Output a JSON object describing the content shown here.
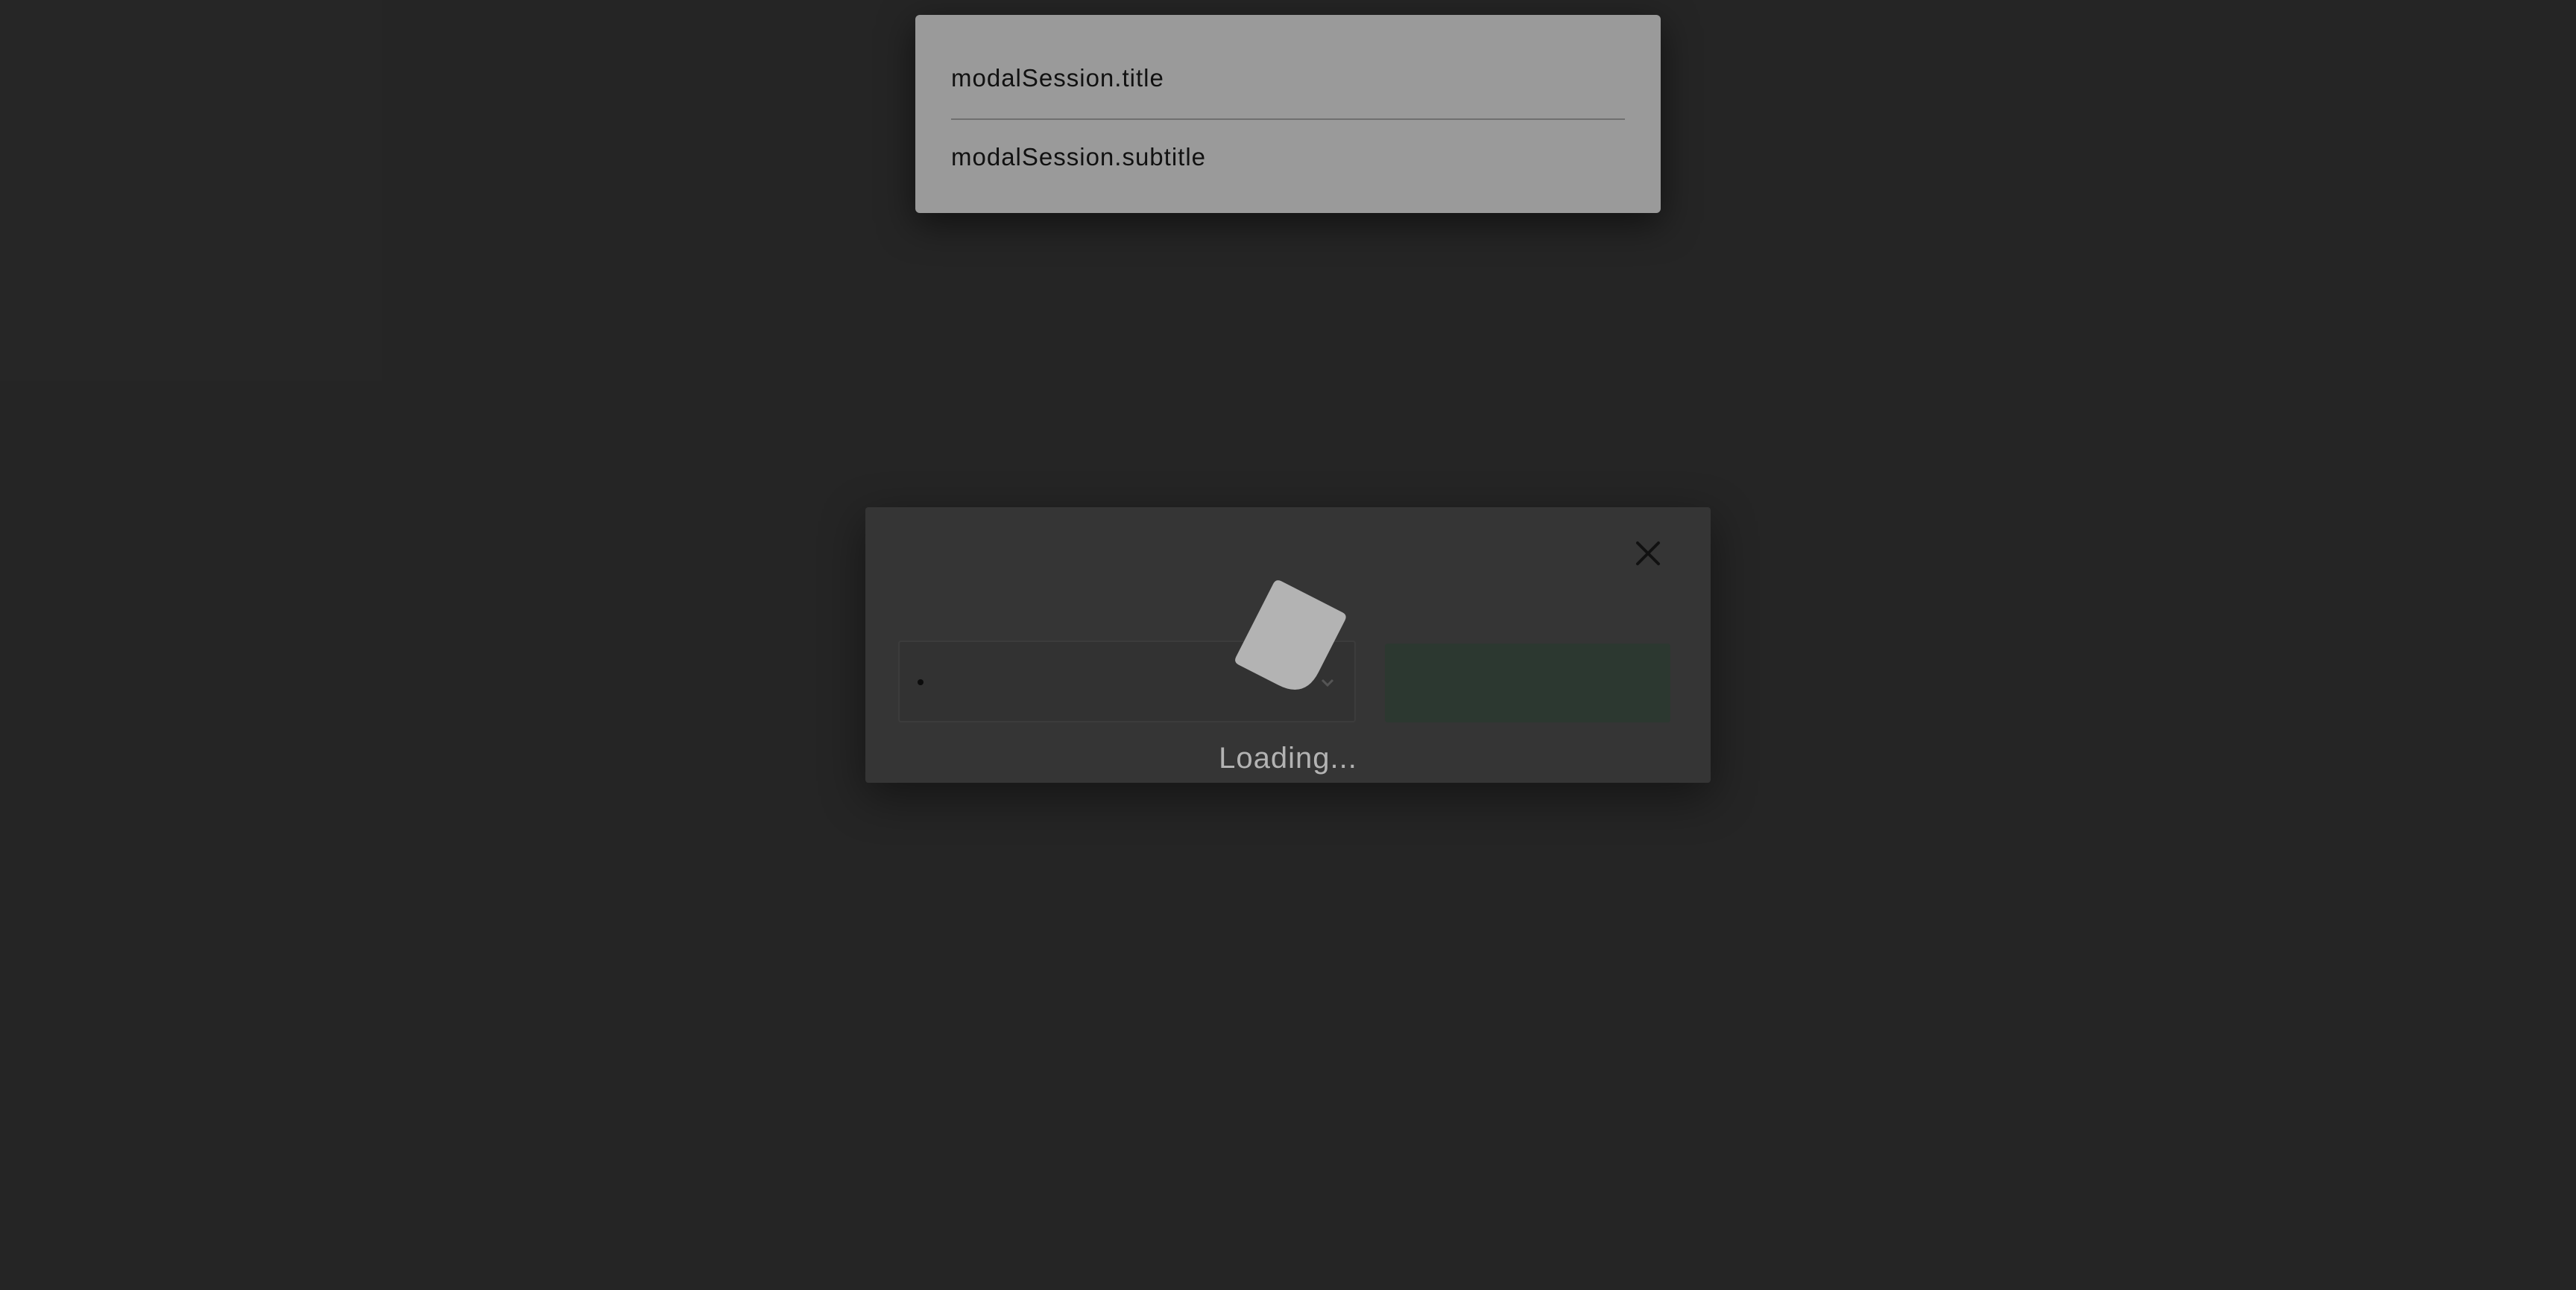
{
  "toast": {
    "title": "modalSession.title",
    "subtitle": "modalSession.subtitle"
  },
  "modal": {
    "close_icon": "close-icon",
    "select_value": "",
    "submit_label": ""
  },
  "loader": {
    "icon": "loading-spinner-icon",
    "text": "Loading..."
  },
  "colors": {
    "background": "#252525",
    "toast_background": "#9a9a9a",
    "modal_background": "#353535",
    "submit_button": "#2c3830",
    "loader_fill": "#b3b3b3"
  }
}
